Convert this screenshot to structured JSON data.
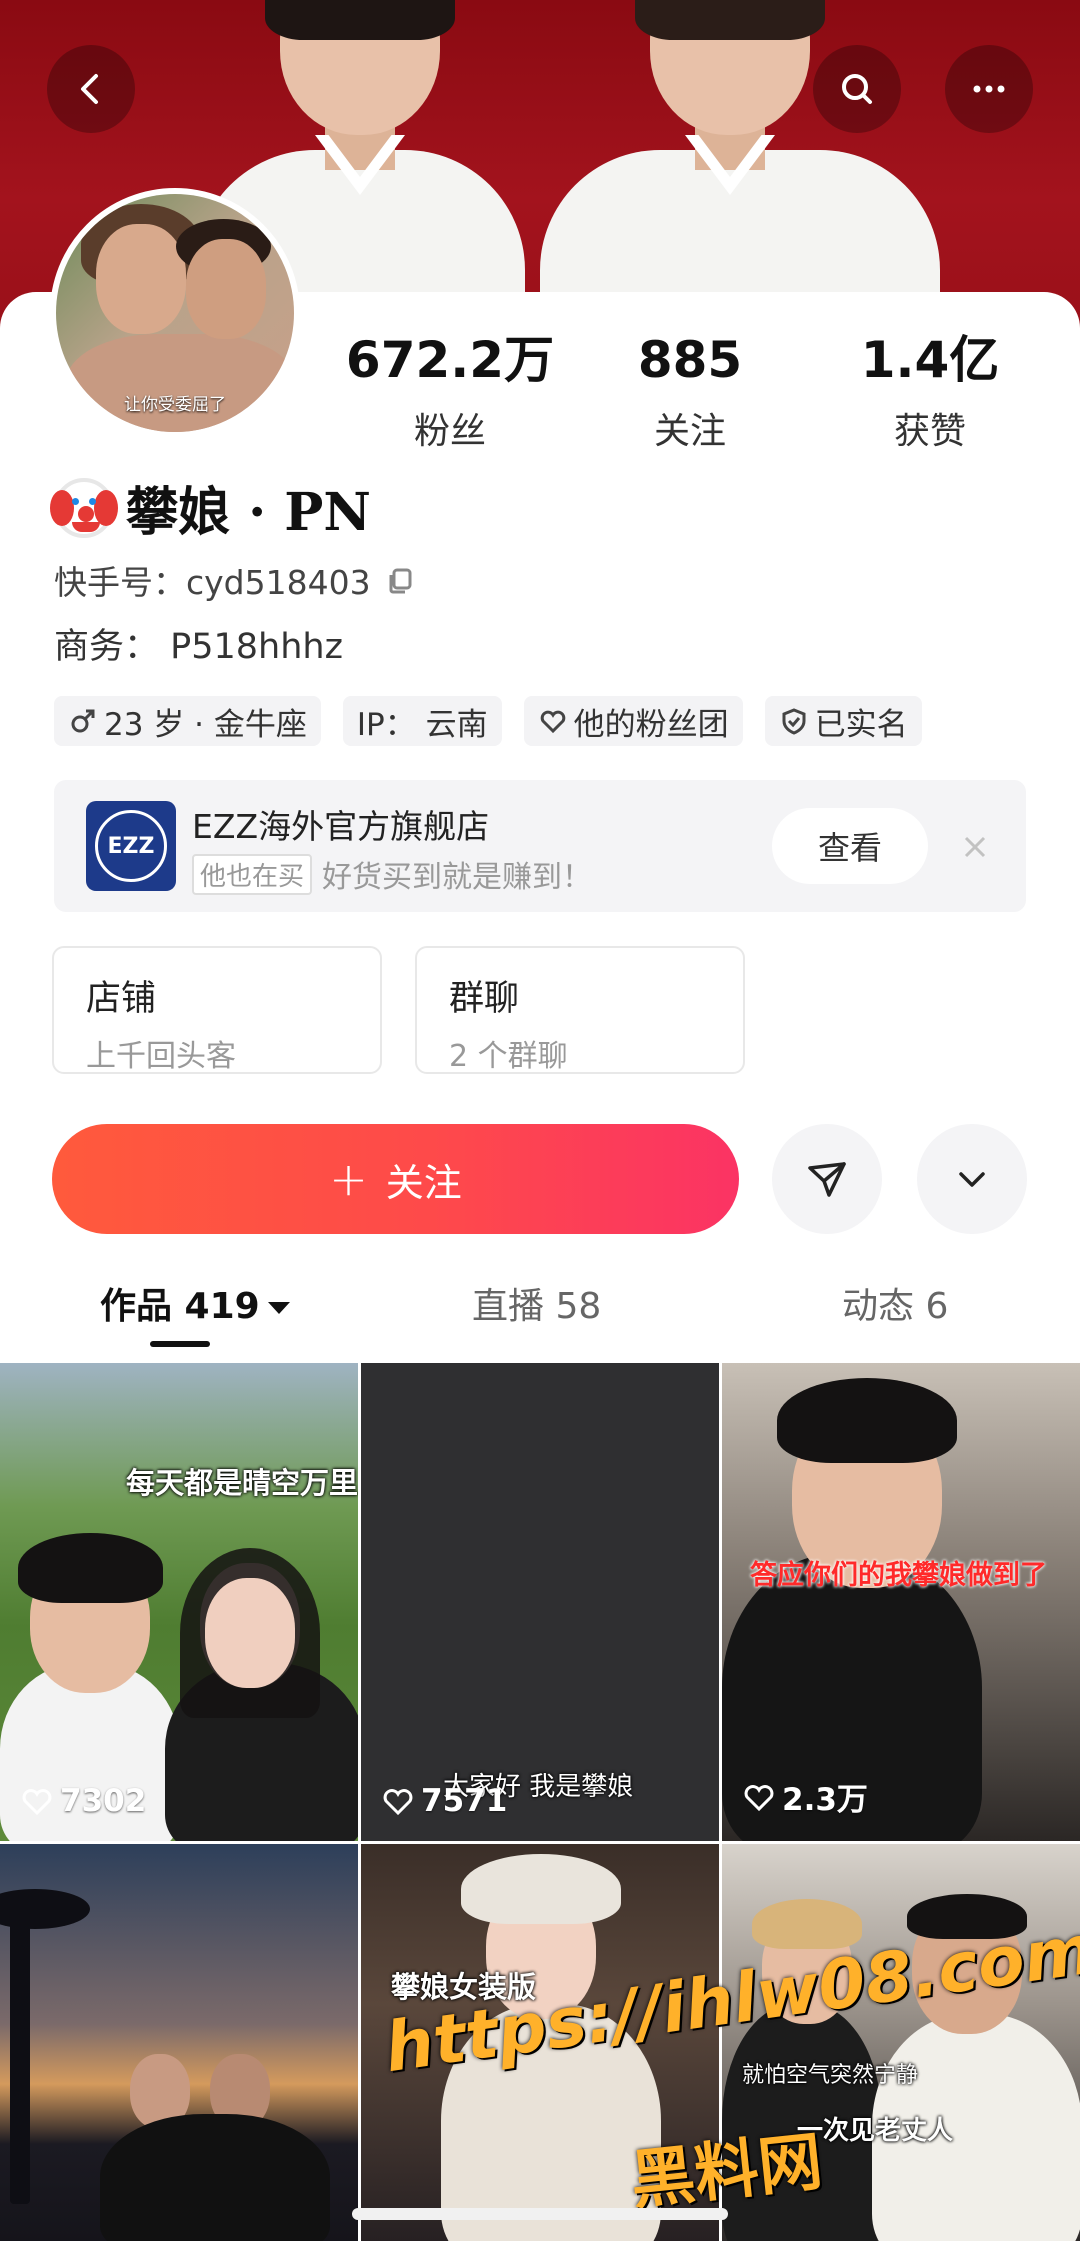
{
  "header": {
    "back_icon": "chevron-left-icon",
    "search_icon": "search-icon",
    "more_icon": "more-horizontal-icon"
  },
  "profile": {
    "avatar_caption": "让你受委屈了",
    "name_emoji": "clown-face-icon",
    "name": "攀娘 · PN",
    "kuaishou_id": "快手号：cyd518403",
    "business": "商务： P518hhhz",
    "stats": [
      {
        "value": "672.2万",
        "label": "粉丝"
      },
      {
        "value": "885",
        "label": "关注"
      },
      {
        "value": "1.4亿",
        "label": "获赞"
      }
    ],
    "tags": [
      {
        "icon": "male-icon",
        "text": "23 岁 · 金牛座"
      },
      {
        "icon": "",
        "text": "IP： 云南"
      },
      {
        "icon": "heart-icon",
        "text": "他的粉丝团"
      },
      {
        "icon": "shield-check-icon",
        "text": "已实名"
      }
    ]
  },
  "shop_promo": {
    "logo_text": "EZZ",
    "name": "EZZ海外官方旗舰店",
    "badge": "他也在买",
    "slogan": "好货买到就是赚到！",
    "view_label": "查看"
  },
  "features": [
    {
      "title": "店铺",
      "subtitle": "上千回头客"
    },
    {
      "title": "群聊",
      "subtitle": "2 个群聊"
    }
  ],
  "actions": {
    "follow_label": "关注",
    "follow_plus": "+",
    "share_icon": "send-icon",
    "expand_icon": "chevron-down-icon"
  },
  "tabs": [
    {
      "label": "作品 419"
    },
    {
      "label": "直播 58"
    },
    {
      "label": "动态 6"
    }
  ],
  "videos": [
    {
      "caption": "每天都是晴空万里",
      "likes": "7302"
    },
    {
      "caption": "大家好 我是攀娘",
      "likes": "7571"
    },
    {
      "caption": "答应你们的我攀娘做到了",
      "likes": "2.3万"
    },
    {
      "caption": "",
      "likes": ""
    },
    {
      "caption": "攀娘女装版",
      "likes": ""
    },
    {
      "caption": "就怕空气突然宁静",
      "caption2": "一次见老丈人",
      "likes": ""
    }
  ],
  "watermark": {
    "url": "https://ihlw08.com",
    "site_name": "黑料网"
  }
}
